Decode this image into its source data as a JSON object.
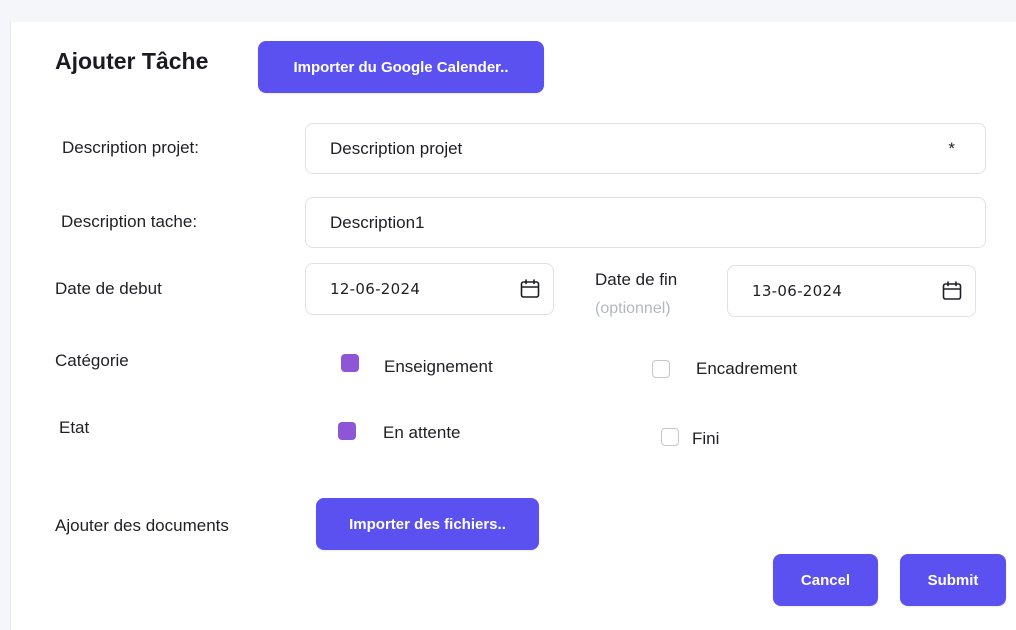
{
  "form": {
    "title": "Ajouter Tâche",
    "import_calendar_label": "Importer du Google Calender..",
    "project_description": {
      "label": "Description projet:",
      "value": "Description projet",
      "required_marker": "*"
    },
    "task_description": {
      "label": "Description tache:",
      "value": "Description1"
    },
    "start_date": {
      "label": "Date de debut",
      "value": "12-06-2024",
      "icon": "calendar-icon"
    },
    "end_date": {
      "label": "Date de fin",
      "sublabel": "(optionnel)",
      "value": "13-06-2024",
      "icon": "calendar-icon"
    },
    "category": {
      "label": "Catégorie",
      "options": [
        {
          "label": "Enseignement",
          "checked": true
        },
        {
          "label": "Encadrement",
          "checked": false
        }
      ]
    },
    "state": {
      "label": "Etat",
      "options": [
        {
          "label": "En attente",
          "checked": true
        },
        {
          "label": "Fini",
          "checked": false
        }
      ]
    },
    "documents": {
      "label": "Ajouter des documents",
      "import_label": "Importer des fichiers.."
    },
    "cancel_label": "Cancel",
    "submit_label": "Submit"
  },
  "colors": {
    "accent": "#5b50f0",
    "checkbox_checked": "#8e56d6",
    "background": "#f5f6fa"
  }
}
